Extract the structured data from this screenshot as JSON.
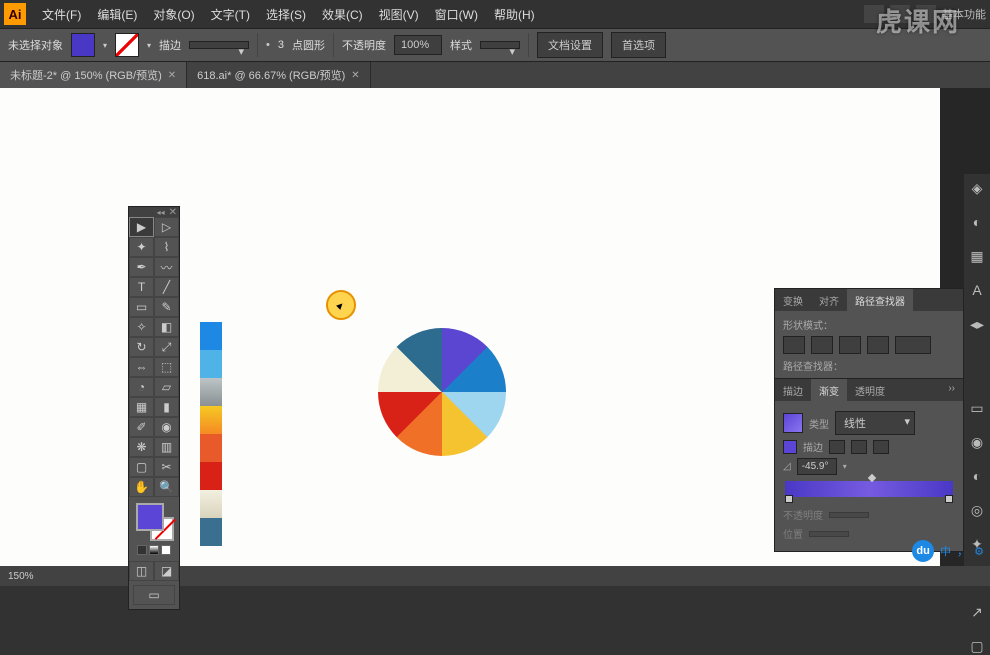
{
  "app_icon": "Ai",
  "menubar": {
    "items": [
      "文件(F)",
      "编辑(E)",
      "对象(O)",
      "文字(T)",
      "选择(S)",
      "效果(C)",
      "视图(V)",
      "窗口(W)",
      "帮助(H)"
    ],
    "right_label": "基本功能"
  },
  "controlbar": {
    "no_selection": "未选择对象",
    "stroke_label": "描边",
    "stroke_weight": "",
    "point_dash_value": "3",
    "point_dash_label": "点圆形",
    "opacity_label": "不透明度",
    "opacity_value": "100%",
    "style_label": "样式",
    "doc_setup": "文档设置",
    "prefs": "首选项"
  },
  "tabs": [
    {
      "label": "未标题-2* @ 150% (RGB/预览)",
      "active": true
    },
    {
      "label": "618.ai* @ 66.67% (RGB/预览)",
      "active": false
    }
  ],
  "toolbox_tools": [
    "selection",
    "direct-selection",
    "wand",
    "lasso",
    "pen",
    "curvature",
    "type",
    "line",
    "rectangle",
    "brush",
    "shaper",
    "eraser",
    "rotate",
    "scale",
    "width",
    "free-transform",
    "shape-builder",
    "perspective",
    "mesh",
    "gradient",
    "eyedropper",
    "blend",
    "symbol-sprayer",
    "column-graph",
    "artboard",
    "slice",
    "hand",
    "zoom"
  ],
  "swatches": [
    "#4938c6",
    "#1e88e5",
    "#4fb3e8",
    "#bcc4c6",
    "#f5a623",
    "#e85a2a",
    "#d82218",
    "#e9e6d9",
    "#3a6f8f"
  ],
  "pie_segments": [
    "#5a46d1",
    "#1c7fc9",
    "#9ed6f0",
    "#f6c330",
    "#f07028",
    "#d82218",
    "#f3efd7",
    "#2d6b8f"
  ],
  "panels": {
    "tabs1": [
      "变换",
      "对齐",
      "路径查找器"
    ],
    "shape_mode_label": "形状模式：",
    "pathfinder_label": "路径查找器：",
    "tabs2": [
      "描边",
      "渐变",
      "透明度"
    ],
    "type_label": "类型",
    "type_value": "线性",
    "stroke_label2": "描边",
    "angle_value": "-45.9°",
    "opacity2_label": "不透明度",
    "position_label": "位置"
  },
  "statusbar": {
    "zoom": "150%"
  },
  "watermark": "虎课网",
  "badges": {
    "du": "du",
    "zhong": "中"
  }
}
